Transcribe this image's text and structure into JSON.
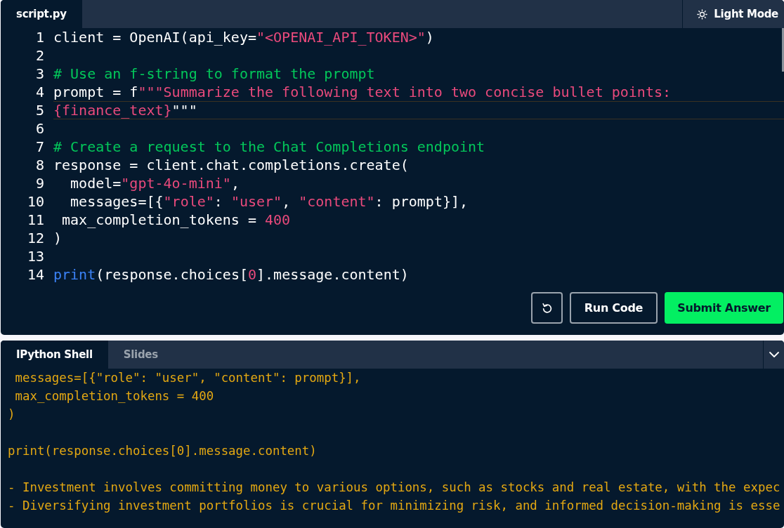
{
  "editor": {
    "tabs": [
      {
        "label": "script.py",
        "selected": true
      }
    ],
    "theme_button": {
      "label": "Light Mode"
    },
    "lines": [
      {
        "number": "1",
        "active": false,
        "tokens": [
          {
            "kind": "plain",
            "text": "client = OpenAI(api_key="
          },
          {
            "kind": "string",
            "text": "\"<OPENAI_API_TOKEN>\""
          },
          {
            "kind": "plain",
            "text": ")"
          }
        ]
      },
      {
        "number": "2",
        "active": false
      },
      {
        "number": "3",
        "active": false,
        "tokens": [
          {
            "kind": "comment",
            "text": "# Use an f-string to format the prompt"
          }
        ]
      },
      {
        "number": "4",
        "active": false,
        "tokens": [
          {
            "kind": "plain",
            "text": "prompt = f"
          },
          {
            "kind": "string",
            "text": "\"\"\"Summarize the following text into two concise bullet points:"
          }
        ]
      },
      {
        "number": "5",
        "active": true,
        "tokens": [
          {
            "kind": "string",
            "text": "{finance_text}"
          },
          {
            "kind": "plain",
            "text": "\"\"\""
          }
        ]
      },
      {
        "number": "6",
        "active": false
      },
      {
        "number": "7",
        "active": false,
        "tokens": [
          {
            "kind": "comment",
            "text": "# Create a request to the Chat Completions endpoint"
          }
        ]
      },
      {
        "number": "8",
        "active": false,
        "tokens": [
          {
            "kind": "plain",
            "text": "response = client.chat.completions.create("
          }
        ]
      },
      {
        "number": "9",
        "active": false,
        "tokens": [
          {
            "kind": "plain",
            "text": "  model="
          },
          {
            "kind": "string",
            "text": "\"gpt-4o-mini\""
          },
          {
            "kind": "plain",
            "text": ","
          }
        ]
      },
      {
        "number": "10",
        "active": false,
        "tokens": [
          {
            "kind": "plain",
            "text": "  messages=[{"
          },
          {
            "kind": "string",
            "text": "\"role\""
          },
          {
            "kind": "plain",
            "text": ": "
          },
          {
            "kind": "string",
            "text": "\"user\""
          },
          {
            "kind": "plain",
            "text": ", "
          },
          {
            "kind": "string",
            "text": "\"content\""
          },
          {
            "kind": "plain",
            "text": ": prompt}],"
          }
        ]
      },
      {
        "number": "11",
        "active": false,
        "tokens": [
          {
            "kind": "plain",
            "text": " max_completion_tokens = "
          },
          {
            "kind": "number",
            "text": "400"
          }
        ]
      },
      {
        "number": "12",
        "active": false,
        "tokens": [
          {
            "kind": "plain",
            "text": ")"
          }
        ]
      },
      {
        "number": "13",
        "active": false
      },
      {
        "number": "14",
        "active": false,
        "tokens": [
          {
            "kind": "keyword",
            "text": "print"
          },
          {
            "kind": "plain",
            "text": "(response.choices["
          },
          {
            "kind": "number",
            "text": "0"
          },
          {
            "kind": "plain",
            "text": "].message.content)"
          }
        ]
      }
    ],
    "buttons": [
      {
        "kind": "reset"
      },
      {
        "kind": "run",
        "label": "Run Code"
      },
      {
        "kind": "submit",
        "label": "Submit Answer"
      }
    ]
  },
  "console": {
    "tabs": [
      {
        "label": "IPython Shell",
        "selected": true
      },
      {
        "label": "Slides",
        "selected": false
      }
    ],
    "lines": [
      {
        "kind": "text",
        "text": " messages=[{\"role\": \"user\", \"content\": prompt}],"
      },
      {
        "kind": "text",
        "text": " max_completion_tokens = 400"
      },
      {
        "kind": "text",
        "text": ")"
      },
      {
        "kind": "blank"
      },
      {
        "kind": "text",
        "text": "print(response.choices[0].message.content)"
      },
      {
        "kind": "blank"
      },
      {
        "kind": "text",
        "text": "- Investment involves committing money to various options, such as stocks and real estate, with the expec"
      },
      {
        "kind": "text",
        "text": "- Diversifying investment portfolios is crucial for minimizing risk, and informed decision-making is esse"
      }
    ]
  }
}
